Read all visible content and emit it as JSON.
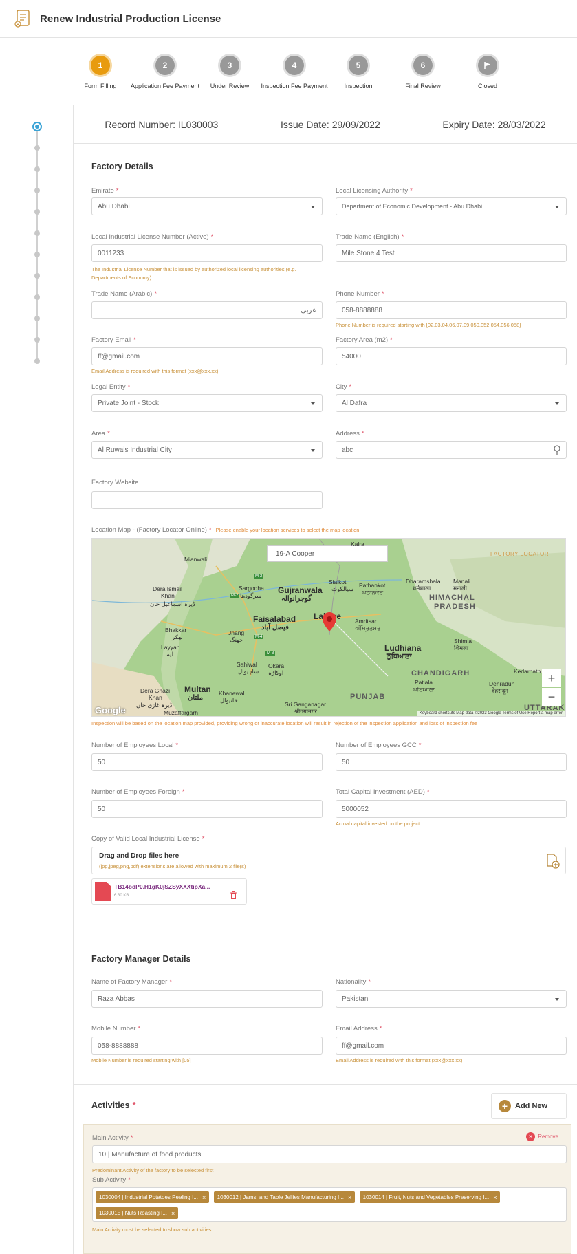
{
  "header": {
    "title": "Renew Industrial Production License"
  },
  "steps": [
    {
      "num": "1",
      "label": "Form Filling"
    },
    {
      "num": "2",
      "label": "Application Fee Payment"
    },
    {
      "num": "3",
      "label": "Under Review"
    },
    {
      "num": "4",
      "label": "Inspection Fee Payment"
    },
    {
      "num": "5",
      "label": "Inspection"
    },
    {
      "num": "6",
      "label": "Final Review"
    },
    {
      "num": "",
      "label": "Closed"
    }
  ],
  "record": {
    "number": "Record Number: IL030003",
    "issue": "Issue Date: 29/09/2022",
    "expiry": "Expiry Date: 28/03/2022"
  },
  "factory": {
    "title": "Factory Details",
    "emirate": {
      "label": "Emirate",
      "value": "Abu Dhabi"
    },
    "authority": {
      "label": "Local Licensing Authority",
      "value": "Department of Economic Development - Abu Dhabi"
    },
    "license_no": {
      "label": "Local Industrial License Number (Active)",
      "value": "0011233",
      "hint": "The Industrial License Number that is issued by authorized local licensing authorities (e.g. Departments of Economy)."
    },
    "trade_en": {
      "label": "Trade Name (English)",
      "value": "Mile Stone 4 Test"
    },
    "trade_ar": {
      "label": "Trade Name (Arabic)",
      "value": "عربی"
    },
    "phone": {
      "label": "Phone Number",
      "value": "058-8888888",
      "hint": "Phone Number is required starting with [02,03,04,06,07,09,050,052,054,056,058]"
    },
    "email": {
      "label": "Factory Email",
      "value": "ff@gmail.com",
      "hint": "Email Address is required with this format (xxx@xxx.xx)"
    },
    "area_m2": {
      "label": "Factory Area (m2)",
      "value": "54000"
    },
    "legal": {
      "label": "Legal Entity",
      "value": "Private Joint - Stock"
    },
    "city": {
      "label": "City",
      "value": "Al Dafra"
    },
    "area": {
      "label": "Area",
      "value": "Al Ruwais Industrial City"
    },
    "address": {
      "label": "Address",
      "value": "abc"
    },
    "website": {
      "label": "Factory Website",
      "value": ""
    },
    "map": {
      "label": "Location Map - (Factory Locator Online)",
      "hint": "Please enable your location services to select the map location",
      "search": "19-A Cooper",
      "brand": "FACTORY LOCATOR",
      "footer": "Keyboard shortcuts   Map data ©2023 Google   Terms of Use   Report a map error",
      "google": "Google",
      "bottom_hint": "Inspection will be based on the location map provided, providing wrong or inaccurate location will result in rejection of the inspection application and loss of inspection fee",
      "places": {
        "kalra": "Kalra",
        "mianwali": "Mianwali",
        "sialkot": "Sialkot",
        "sialkot_ur": "سیالکوٹ",
        "gujranwala": "Gujranwala",
        "gujranwala_ur": "گوجرانوالہ",
        "sargodha": "Sargodha",
        "sargodha_ur": "سرگودھا",
        "pathankot": "Pathankot",
        "pathankot_pa": "ਪਠਾਨਕੋਟ",
        "dharamshala": "Dharamshala",
        "dharamshala_hi": "धर्मशाला",
        "manali": "Manali",
        "manali_hi": "मनाली",
        "himachal": "HIMACHAL",
        "pradesh": "PRADESH",
        "dera_ismail": "Dera Ismail",
        "khan1": "Khan",
        "dera_ismail_ur": "ڈیرہ اسماعیل خان",
        "faisalabad": "Faisalabad",
        "faisalabad_ur": "فیصل آباد",
        "lahore": "Lahore",
        "amritsar": "Amritsar",
        "amritsar_pa": "ਅੰਮ੍ਰਿਤਸਰ",
        "bhakkar": "Bhakkar",
        "bhakkar_ur": "بھکر",
        "jhang": "Jhang",
        "jhang_ur": "جھنگ",
        "layyah": "Layyah",
        "layyah_ur": "لیہ",
        "ludhiana": "Ludhiana",
        "ludhiana_pa": "ਲੁਧਿਆਣਾ",
        "shimla": "Shimla",
        "shimla_hi": "शिमला",
        "sahiwal": "Sahiwal",
        "sahiwal_ur": "ساہیوال",
        "okara": "Okara",
        "okara_ur": "اوکاڑہ",
        "chandigarh": "CHANDIGARH",
        "patiala": "Patiala",
        "patiala_pa": "ਪਟਿਆਲਾ",
        "kedarnath": "Kedarnath",
        "dera_ghazi": "Dera Ghazi",
        "khan2": "Khan",
        "dera_ghazi_ur": "ڈیرہ غازی خان",
        "multan": "Multan",
        "multan_ur": "ملتان",
        "khanewal": "Khanewal",
        "khanewal_ur": "خانیوال",
        "muzaffargarh": "Muzaffargarh",
        "punjab": "PUNJAB",
        "sri_ganganagar": "Sri Ganganagar",
        "sri_ganganagar_hi": "श्रीगंगानगर",
        "dehradun": "Dehradun",
        "dehradun_hi": "देहरादून",
        "uttarakh": "UTTARAKH",
        "m2a": "M-2",
        "m2b": "M-2",
        "m4a": "M-4",
        "m3": "M-3"
      }
    },
    "emp_local": {
      "label": "Number of Employees Local",
      "value": "50"
    },
    "emp_gcc": {
      "label": "Number of Employees GCC",
      "value": "50"
    },
    "emp_foreign": {
      "label": "Number of Employees Foreign",
      "value": "50"
    },
    "capital": {
      "label": "Total Capital Investment (AED)",
      "value": "5000052",
      "hint": "Actual capital invested on the project"
    },
    "copy": {
      "label": "Copy of Valid Local Industrial License",
      "drop_title": "Drag and Drop files here",
      "drop_hint": "(jpg,jpeg,png,pdf) extensions are allowed with maximum 2 file(s)"
    },
    "file": {
      "name": "TB14bdP0.H1gK0jSZSyXXXtipXa...",
      "size": "6.30 KB"
    }
  },
  "manager": {
    "title": "Factory Manager Details",
    "name": {
      "label": "Name of Factory Manager",
      "value": "Raza Abbas"
    },
    "nationality": {
      "label": "Nationality",
      "value": "Pakistan"
    },
    "mobile": {
      "label": "Mobile Number",
      "value": "058-8888888",
      "hint": "Mobile Number is required starting with [05]"
    },
    "email": {
      "label": "Email Address",
      "value": "ff@gmail.com",
      "hint": "Email Address is required with this format (xxx@xxx.xx)"
    }
  },
  "activities": {
    "title": "Activities",
    "add_new": "Add New",
    "remove": "Remove",
    "main": {
      "label": "Main Activity",
      "value": "10 | Manufacture of food products",
      "hint": "Predominant Activity of the factory to be selected first"
    },
    "sub": {
      "label": "Sub Activity",
      "tags": [
        "1030004 | Industrial Potatoes Peeling I...",
        "1030012 | Jams, and Table Jellies Manufacturing I...",
        "1030014 | Fruit, Nuts and Vegetables Preserving I...",
        "1030015 | Nuts Roasting I..."
      ],
      "hint": "Main Activity must be selected to show sub activities"
    }
  },
  "colors": {
    "accent": "#e89b0f",
    "tag": "#b7883b",
    "required": "#e0566b",
    "hint": "#c8913a",
    "rail": "#3aa3d6"
  }
}
